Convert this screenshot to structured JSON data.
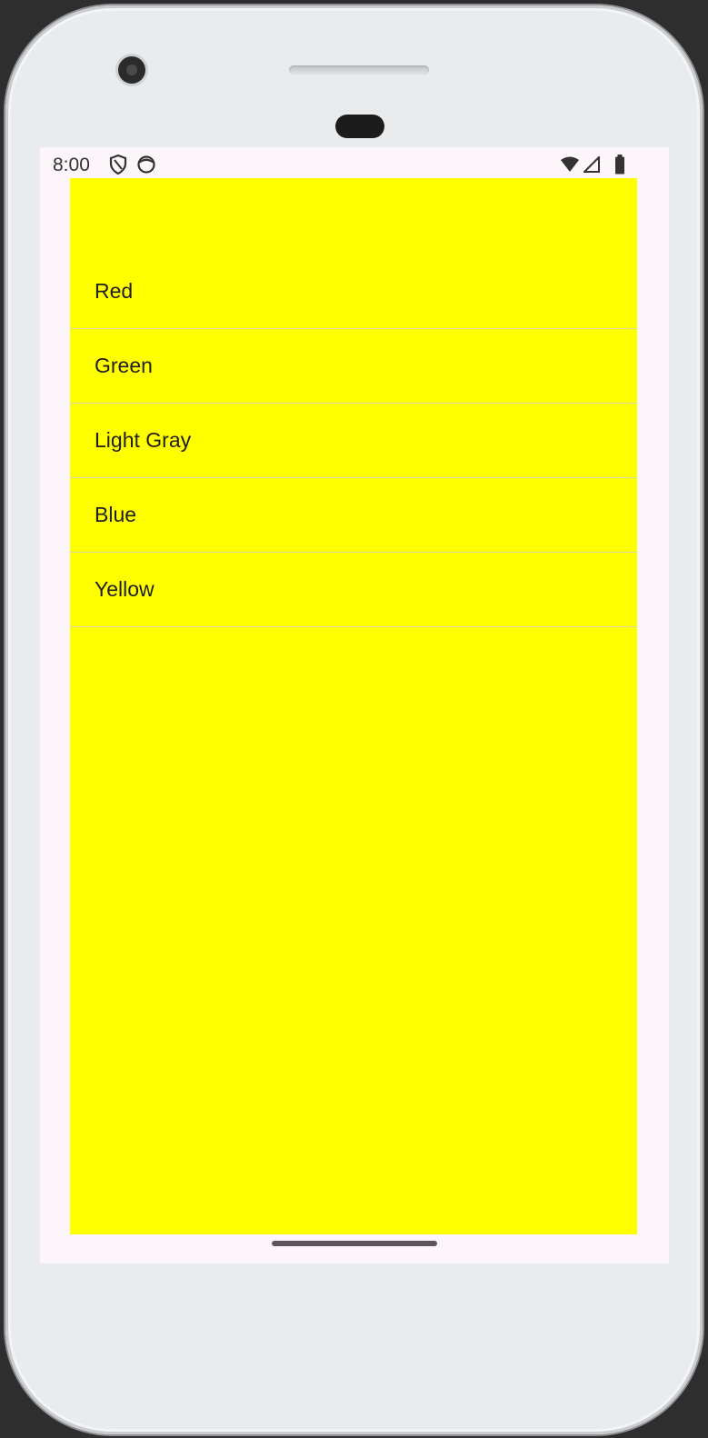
{
  "status_bar": {
    "time": "8:00",
    "left_icons": [
      "shield-icon",
      "mask-icon"
    ],
    "right_icons": [
      "wifi-icon",
      "signal-icon",
      "battery-icon"
    ]
  },
  "list": {
    "background_color": "#ffff00",
    "items": [
      {
        "label": "Red"
      },
      {
        "label": "Green"
      },
      {
        "label": "Light Gray"
      },
      {
        "label": "Blue"
      },
      {
        "label": "Yellow"
      }
    ]
  }
}
